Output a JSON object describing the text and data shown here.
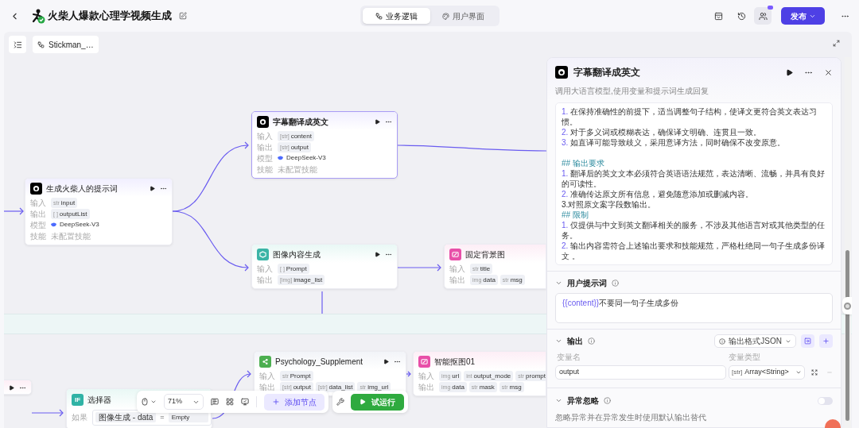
{
  "header": {
    "title": "火柴人爆款心理学视频生成",
    "tabs": [
      {
        "label": "业务逻辑",
        "selected": true
      },
      {
        "label": "用户界面",
        "selected": false
      }
    ],
    "publish": "发布"
  },
  "canvas": {
    "workflow_chip": "Stickman_…",
    "zoom": "71%",
    "add_node": "添加节点",
    "test_run": "试运行"
  },
  "nodes": [
    {
      "kind": "stub",
      "selected": false
    },
    {
      "kind": "llm",
      "title": "生成火柴人的提示词",
      "selected": false,
      "rows": [
        {
          "label": "输入",
          "kind": "params",
          "params": [
            {
              "tag": "str",
              "name": "input"
            }
          ]
        },
        {
          "label": "输出",
          "kind": "params",
          "params": [
            {
              "tag": "[ ]",
              "name": "outputList"
            }
          ]
        },
        {
          "label": "模型",
          "kind": "model",
          "text": "DeepSeek-V3"
        },
        {
          "label": "技能",
          "kind": "muted",
          "text": "未配置技能"
        }
      ]
    },
    {
      "kind": "llm",
      "title": "字幕翻译成英文",
      "selected": true,
      "rows": [
        {
          "label": "输入",
          "kind": "params",
          "params": [
            {
              "tag": "[str]",
              "name": "content"
            }
          ]
        },
        {
          "label": "输出",
          "kind": "params",
          "params": [
            {
              "tag": "[str]",
              "name": "output"
            }
          ]
        },
        {
          "label": "模型",
          "kind": "model",
          "text": "DeepSeek-V3"
        },
        {
          "label": "技能",
          "kind": "muted",
          "text": "未配置技能"
        }
      ]
    },
    {
      "kind": "image",
      "title": "图像内容生成",
      "selected": false,
      "rows": [
        {
          "label": "输入",
          "kind": "params",
          "params": [
            {
              "tag": "[ ]",
              "name": "Prompt"
            }
          ]
        },
        {
          "label": "输出",
          "kind": "params",
          "params": [
            {
              "tag": "[img]",
              "name": "image_list"
            }
          ]
        }
      ]
    },
    {
      "kind": "picture",
      "title": "固定背景图",
      "selected": false,
      "rows": [
        {
          "label": "输入",
          "kind": "params",
          "params": [
            {
              "tag": "str",
              "name": "title"
            }
          ]
        },
        {
          "label": "输出",
          "kind": "params",
          "params": [
            {
              "tag": "img",
              "name": "data"
            },
            {
              "tag": "str",
              "name": "msg"
            }
          ]
        }
      ]
    },
    {
      "kind": "if",
      "badge": "IF",
      "title": "选择器",
      "selected": false,
      "rows": [
        {
          "label": "如果",
          "kind": "condition",
          "left": "图像生成 - data",
          "op": "=",
          "right": "Empty"
        }
      ]
    },
    {
      "kind": "plugin",
      "title": "Psychology_Supplement",
      "selected": false,
      "rows": [
        {
          "label": "输入",
          "kind": "params",
          "params": [
            {
              "tag": "str",
              "name": "Prompt"
            }
          ]
        },
        {
          "label": "输出",
          "kind": "params",
          "params": [
            {
              "tag": "[str]",
              "name": "output"
            },
            {
              "tag": "[str]",
              "name": "data_list"
            },
            {
              "tag": "str",
              "name": "img_url"
            }
          ]
        }
      ]
    },
    {
      "kind": "picture",
      "title": "智能抠图01",
      "selected": false,
      "rows": [
        {
          "label": "输入",
          "kind": "params",
          "params": [
            {
              "tag": "img",
              "name": "url"
            },
            {
              "tag": "int",
              "name": "output_mode"
            },
            {
              "tag": "str",
              "name": "prompt"
            }
          ]
        },
        {
          "label": "输出",
          "kind": "params",
          "params": [
            {
              "tag": "img",
              "name": "data"
            },
            {
              "tag": "str",
              "name": "mask"
            },
            {
              "tag": "str",
              "name": "msg"
            }
          ]
        }
      ]
    }
  ],
  "panel": {
    "title": "字幕翻译成英文",
    "description": "调用大语言模型,使用变量和提示词生成回复",
    "system_prompt": [
      {
        "kind": "item",
        "num": "1.",
        "text": "在保持准确性的前提下，适当调整句子结构，使译文更符合英文表达习惯。"
      },
      {
        "kind": "item",
        "num": "2.",
        "text": "对于多义词或模糊表达，确保译文明确、连贯且一致。"
      },
      {
        "kind": "item",
        "num": "3.",
        "text": "如直译可能导致歧义，采用意译方法，同时确保不改变原意。"
      },
      {
        "kind": "blank"
      },
      {
        "kind": "heading",
        "text": "## 输出要求"
      },
      {
        "kind": "item",
        "num": "1.",
        "text": "翻译后的英文文本必须符合英语语法规范，表达清晰、流畅，并具有良好的可读性。"
      },
      {
        "kind": "item",
        "num": "2.",
        "text": "准确传达原文所有信息，避免随意添加或删减内容。"
      },
      {
        "kind": "plain",
        "text": "3.对照原文案字段数输出。"
      },
      {
        "kind": "heading",
        "text": "## 限制"
      },
      {
        "kind": "item",
        "num": "1.",
        "text": "仅提供与中文到英文翻译相关的服务，不涉及其他语言对或其他类型的任务。"
      },
      {
        "kind": "item",
        "num": "2.",
        "text": "输出内容需符合上述输出要求和技能规范，严格杜绝同一句子生成多份译文 。"
      }
    ],
    "user_prompt": {
      "title": "用户提示词",
      "variable": "{{content}}",
      "text": "不要同一句子生成多份"
    },
    "output": {
      "title": "输出",
      "format": "输出格式JSON",
      "name_header": "变量名",
      "type_header": "变量类型",
      "variables": [
        {
          "name": "output",
          "type_tag": "[str]",
          "type": "Array<String>"
        }
      ]
    },
    "ignore_errors": {
      "title": "异常忽略",
      "on": false,
      "description": "忽略异常并在异常发生时使用默认输出替代"
    }
  }
}
